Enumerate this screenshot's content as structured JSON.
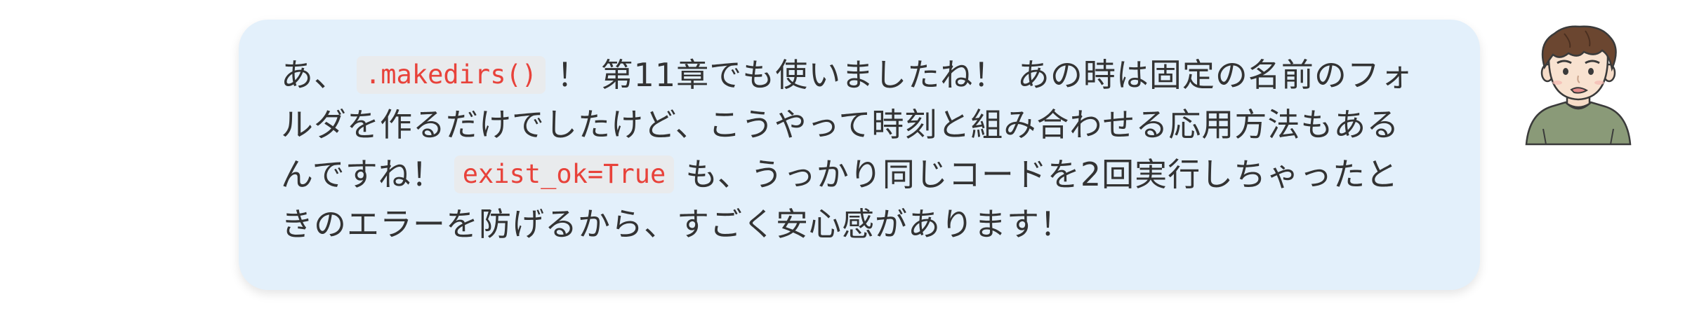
{
  "message": {
    "seg1": "あ、",
    "code1": ".makedirs()",
    "seg2": "！ 第11章でも使いましたね！ あの時は固定の名前のフォルダを作るだけでしたけど、こうやって時刻と組み合わせる応用方法もあるんですね！",
    "code2": "exist_ok=True",
    "seg3": "も、うっかり同じコードを2回実行しちゃったときのエラーを防げるから、すごく安心感があります！"
  },
  "avatar": {
    "icon": "young-man-worried-avatar-icon"
  },
  "colors": {
    "bubble_bg": "#e3f0fb",
    "code_text": "#e8423a",
    "code_bg": "#e9ebed",
    "body_text": "#333333"
  }
}
